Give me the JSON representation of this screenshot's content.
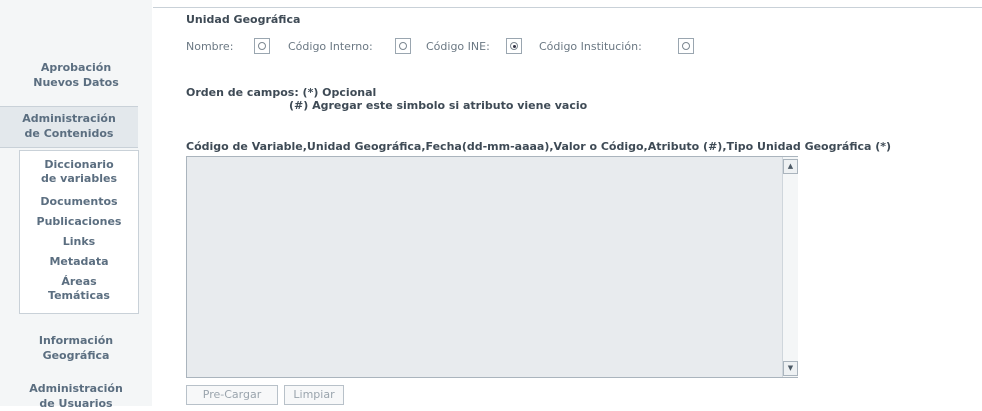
{
  "sidebar": {
    "aprobacion": [
      "Aprobación",
      "Nuevos Datos"
    ],
    "admin_contenidos": [
      "Administración",
      "de Contenidos"
    ],
    "submenu": [
      [
        "Diccionario",
        "de variables"
      ],
      [
        "Documentos"
      ],
      [
        "Publicaciones"
      ],
      [
        "Links"
      ],
      [
        "Metadata"
      ],
      [
        "Áreas",
        "Temáticas"
      ]
    ],
    "info_geo": [
      "Información",
      "Geográfica"
    ],
    "admin_usuarios": [
      "Administración",
      "de Usuarios"
    ]
  },
  "unidad": {
    "title": "Unidad Geográfica",
    "options": [
      "Nombre:",
      "Código Interno:",
      "Código INE:",
      "Código Institución:"
    ],
    "selected": "Código INE:"
  },
  "orden": {
    "line1": "Orden de campos: (*) Opcional",
    "line2": "(#) Agregar este simbolo si atributo viene vacio"
  },
  "campos_header": "Código de Variable,Unidad Geográfica,Fecha(dd-mm-aaaa),Valor o Código,Atributo (#),Tipo Unidad Geográfica (*)",
  "textarea_value": "",
  "buttons": {
    "precargar": "Pre-Cargar",
    "limpiar": "Limpiar"
  }
}
